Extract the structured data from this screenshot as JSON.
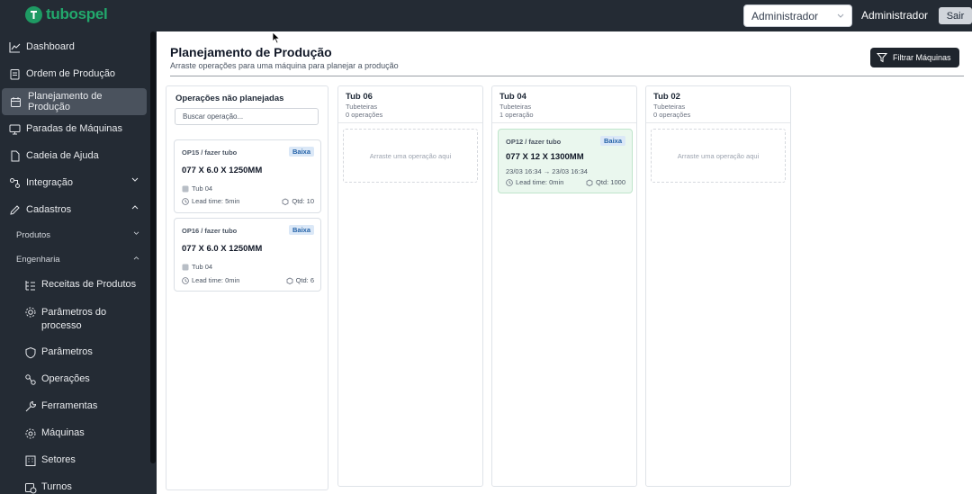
{
  "header": {
    "logo_text": "tubospel",
    "role_select_value": "Administrador",
    "user_name": "Administrador",
    "logout_label": "Sair"
  },
  "sidebar": {
    "items": [
      {
        "label": "Dashboard",
        "icon": "chart-line-icon"
      },
      {
        "label": "Ordem de Produção",
        "icon": "clipboard-icon"
      },
      {
        "label": "Planejamento de Produção",
        "icon": "calendar-icon",
        "active": true
      },
      {
        "label": "Paradas de Máquinas",
        "icon": "monitor-icon"
      },
      {
        "label": "Cadeia de Ajuda",
        "icon": "document-icon"
      },
      {
        "label": "Integração",
        "icon": "integration-icon",
        "expandable": true
      },
      {
        "label": "Cadastros",
        "icon": "pencil-icon",
        "expanded": true
      }
    ],
    "cadastros_sub": {
      "produtos": "Produtos",
      "engenharia": "Engenharia"
    },
    "engenharia_items": [
      {
        "label": "Receitas de Produtos",
        "icon": "list-tree-icon"
      },
      {
        "label": "Parâmetros do processo",
        "icon": "gear-icon"
      },
      {
        "label": "Parâmetros",
        "icon": "shield-icon"
      },
      {
        "label": "Operações",
        "icon": "operations-icon"
      },
      {
        "label": "Ferramentas",
        "icon": "wrench-icon"
      },
      {
        "label": "Máquinas",
        "icon": "cog-icon"
      },
      {
        "label": "Setores",
        "icon": "building-icon"
      },
      {
        "label": "Turnos",
        "icon": "clock-calendar-icon"
      }
    ]
  },
  "main": {
    "title": "Planejamento de Produção",
    "subtitle": "Arraste operações para uma máquina para planejar a produção",
    "filter_button": "Filtrar Máquinas",
    "unplanned": {
      "title": "Operações não planejadas",
      "search_placeholder": "Buscar operação...",
      "cards": [
        {
          "op": "OP15 / fazer tubo",
          "priority": "Baixa",
          "product": "077 X 6.0 X 1250MM",
          "machine": "Tub 04",
          "lead": "Lead time: 5min",
          "qty": "Qtd: 10"
        },
        {
          "op": "OP16 / fazer tubo",
          "priority": "Baixa",
          "product": "077 X 6.0 X 1250MM",
          "machine": "Tub 04",
          "lead": "Lead time: 0min",
          "qty": "Qtd: 6"
        }
      ]
    },
    "machines": [
      {
        "name": "Tub 06",
        "group": "Tubeteiras",
        "count": "0 operações",
        "drop_text": "Arraste uma operação aqui"
      },
      {
        "name": "Tub 04",
        "group": "Tubeteiras",
        "count": "1 operação",
        "card": {
          "op": "OP12 / fazer tubo",
          "priority": "Baixa",
          "product": "077 X 12 X 1300MM",
          "dates": "23/03 16:34 → 23/03 16:34",
          "lead": "Lead time: 0min",
          "qty": "Qtd: 1000"
        }
      },
      {
        "name": "Tub 02",
        "group": "Tubeteiras",
        "count": "0 operações",
        "drop_text": "Arraste uma operação aqui"
      }
    ]
  },
  "colors": {
    "sidebar_bg": "#242b34",
    "brand_green": "#22a86c",
    "badge_bg": "#dbe8f7",
    "planned_card_bg": "#eaf7ee"
  }
}
